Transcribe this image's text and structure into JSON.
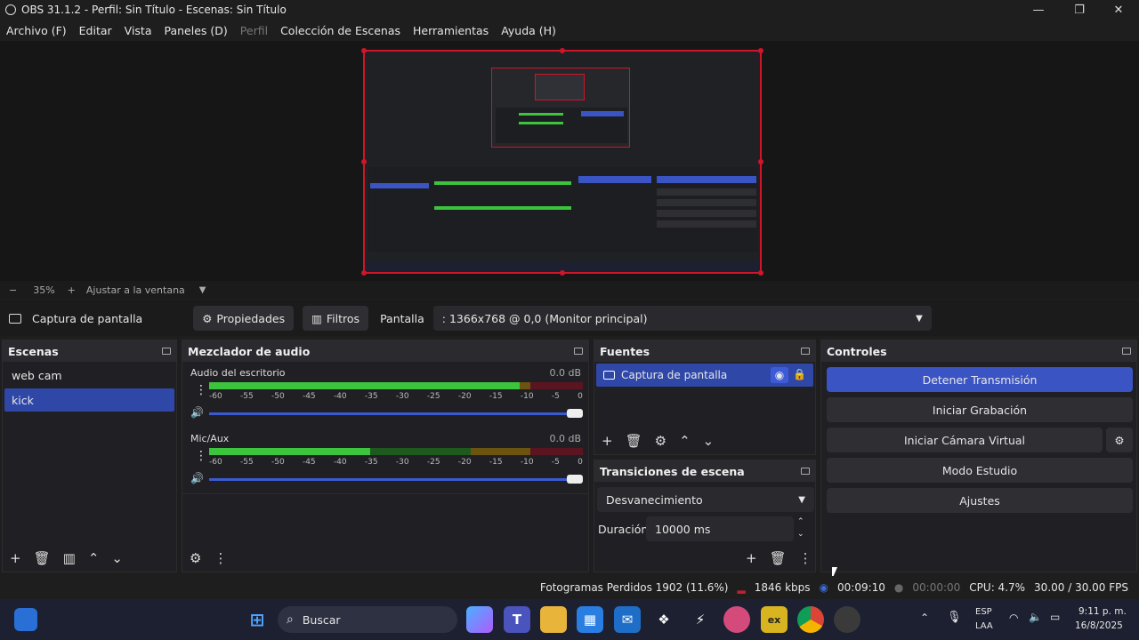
{
  "window": {
    "title": "OBS 31.1.2 - Perfil: Sin Título - Escenas: Sin Título"
  },
  "menu": [
    "Archivo (F)",
    "Editar",
    "Vista",
    "Paneles (D)",
    "Perfil",
    "Colección de Escenas",
    "Herramientas",
    "Ayuda (H)"
  ],
  "zoom": {
    "minus": "−",
    "value": "35%",
    "plus": "+",
    "fit": "Ajustar a la ventana"
  },
  "source_bar": {
    "source_name": "Captura de pantalla",
    "properties": "Propiedades",
    "filters": "Filtros",
    "display_label": "Pantalla",
    "display_value": ": 1366x768 @ 0,0 (Monitor principal)"
  },
  "scenes": {
    "title": "Escenas",
    "items": [
      "web cam",
      "kick"
    ],
    "selected": "kick"
  },
  "mixer": {
    "title": "Mezclador de audio",
    "channels": [
      {
        "name": "Audio del escritorio",
        "db": "0.0 dB",
        "level": 0.83
      },
      {
        "name": "Mic/Aux",
        "db": "0.0 dB",
        "level": 0.43
      }
    ],
    "scale": [
      "-60",
      "-55",
      "-50",
      "-45",
      "-40",
      "-35",
      "-30",
      "-25",
      "-20",
      "-15",
      "-10",
      "-5",
      "0"
    ]
  },
  "sources": {
    "title": "Fuentes",
    "items": [
      "Captura de pantalla"
    ]
  },
  "transitions": {
    "title": "Transiciones de escena",
    "type": "Desvanecimiento",
    "duration_label": "Duración",
    "duration_value": "10000 ms"
  },
  "controls": {
    "title": "Controles",
    "stop_stream": "Detener Transmisión",
    "start_record": "Iniciar Grabación",
    "virtual_cam": "Iniciar Cámara Virtual",
    "studio_mode": "Modo Estudio",
    "settings": "Ajustes"
  },
  "status": {
    "dropped": "Fotogramas Perdidos 1902 (11.6%)",
    "bitrate": "1846 kbps",
    "stream_time": "00:09:10",
    "record_time": "00:00:00",
    "cpu": "CPU: 4.7%",
    "fps": "30.00 / 30.00 FPS"
  },
  "taskbar": {
    "search": "Buscar",
    "lang": "ESP",
    "lang2": "LAA",
    "time": "9:11 p. m.",
    "date": "16/8/2025"
  },
  "colors": {
    "accent": "#3b54c4",
    "selection": "#d0152a",
    "panel": "#202024"
  }
}
